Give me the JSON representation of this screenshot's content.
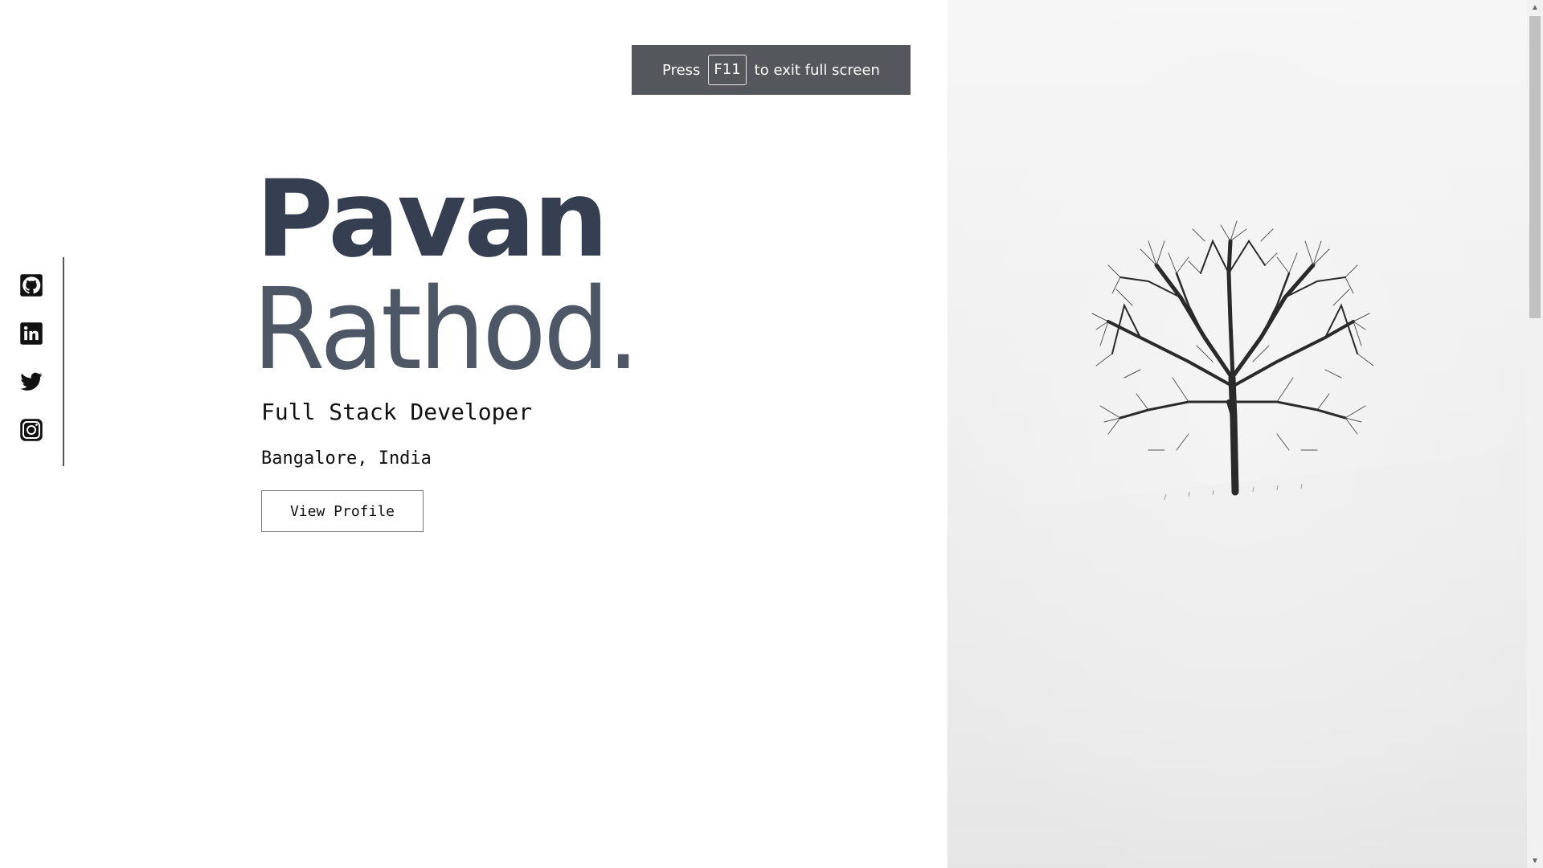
{
  "fullscreen_toast": {
    "prefix": "Press",
    "key": "F11",
    "suffix": "to exit full screen"
  },
  "hero": {
    "first_name": "Pavan",
    "last_name": "Rathod.",
    "role": "Full Stack Developer",
    "location": "Bangalore, India",
    "cta_label": "View Profile"
  },
  "social": [
    {
      "name": "github",
      "icon": "github-icon"
    },
    {
      "name": "linkedin",
      "icon": "linkedin-icon"
    },
    {
      "name": "twitter",
      "icon": "twitter-icon"
    },
    {
      "name": "instagram",
      "icon": "instagram-icon"
    }
  ],
  "colors": {
    "name_first": "#353f51",
    "name_last": "#4d5766",
    "toast_bg": "#54575b"
  }
}
